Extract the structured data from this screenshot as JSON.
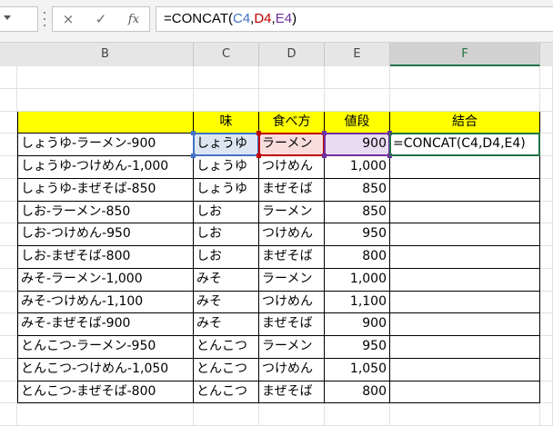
{
  "formula_bar": {
    "cancel_icon": "×",
    "enter_icon": "✓",
    "fx_label": "fx",
    "prefix": "=CONCAT(",
    "ref_c": "C4",
    "sep1": ",",
    "ref_d": "D4",
    "sep2": ",",
    "ref_e": "E4",
    "suffix": ")"
  },
  "columns": [
    "B",
    "C",
    "D",
    "E",
    "F"
  ],
  "selected_column": "F",
  "table": {
    "headers": [
      "",
      "味",
      "食べ方",
      "値段",
      "結合"
    ],
    "editing_value": "=CONCAT(C4,D4,E4)",
    "rows": [
      [
        "しょうゆ-ラーメン-900",
        "しょうゆ",
        "ラーメン",
        "900"
      ],
      [
        "しょうゆ-つけめん-1,000",
        "しょうゆ",
        "つけめん",
        "1,000"
      ],
      [
        "しょうゆ-まぜそば-850",
        "しょうゆ",
        "まぜそば",
        "850"
      ],
      [
        "しお-ラーメン-850",
        "しお",
        "ラーメン",
        "850"
      ],
      [
        "しお-つけめん-950",
        "しお",
        "つけめん",
        "950"
      ],
      [
        "しお-まぜそば-800",
        "しお",
        "まぜそば",
        "800"
      ],
      [
        "みそ-ラーメン-1,000",
        "みそ",
        "ラーメン",
        "1,000"
      ],
      [
        "みそ-つけめん-1,100",
        "みそ",
        "つけめん",
        "1,100"
      ],
      [
        "みそ-まぜそば-900",
        "みそ",
        "まぜそば",
        "900"
      ],
      [
        "とんこつ-ラーメン-950",
        "とんこつ",
        "ラーメン",
        "950"
      ],
      [
        "とんこつ-つけめん-1,050",
        "とんこつ",
        "つけめん",
        "1,050"
      ],
      [
        "とんこつ-まぜそば-800",
        "とんこつ",
        "まぜそば",
        "800"
      ]
    ]
  },
  "colors": {
    "header_fill": "#ffff00",
    "ref_c": "#4472c4",
    "ref_d": "#c00000",
    "ref_e": "#7030a0",
    "active_cell": "#217346"
  }
}
